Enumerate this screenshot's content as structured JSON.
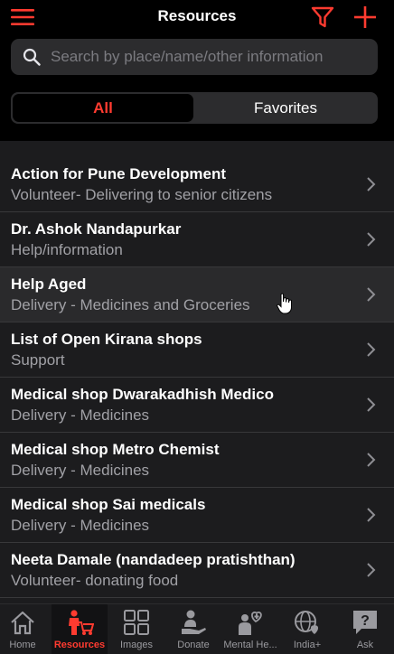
{
  "header": {
    "title": "Resources",
    "menu_icon": "hamburger-menu-icon",
    "filter_icon": "filter-funnel-icon",
    "add_icon": "plus-icon",
    "accent_color": "#ff3b30"
  },
  "search": {
    "placeholder": "Search by place/name/other information",
    "value": ""
  },
  "segments": {
    "all_label": "All",
    "favorites_label": "Favorites",
    "selected": "All"
  },
  "resources": [
    {
      "name": "Action for Pune Development",
      "detail": "Volunteer- Delivering to senior citizens"
    },
    {
      "name": "Dr. Ashok Nandapurkar",
      "detail": "Help/information"
    },
    {
      "name": "Help Aged",
      "detail": "Delivery - Medicines and Groceries"
    },
    {
      "name": "List of Open Kirana shops",
      "detail": "Support"
    },
    {
      "name": "Medical shop Dwarakadhish Medico",
      "detail": "Delivery - Medicines"
    },
    {
      "name": "Medical shop Metro Chemist",
      "detail": "Delivery - Medicines"
    },
    {
      "name": "Medical shop Sai medicals",
      "detail": "Delivery - Medicines"
    },
    {
      "name": "Neeta Damale (nandadeep pratishthan)",
      "detail": "Volunteer- donating food"
    }
  ],
  "tabs": [
    {
      "label": "Home",
      "icon": "home-icon"
    },
    {
      "label": "Resources",
      "icon": "resources-person-cart-icon"
    },
    {
      "label": "Images",
      "icon": "images-grid-icon"
    },
    {
      "label": "Donate",
      "icon": "donate-hand-icon"
    },
    {
      "label": "Mental He...",
      "icon": "mental-health-heart-icon"
    },
    {
      "label": "India+",
      "icon": "globe-heart-icon"
    },
    {
      "label": "Ask",
      "icon": "question-bubble-icon"
    }
  ],
  "active_tab": "Resources"
}
